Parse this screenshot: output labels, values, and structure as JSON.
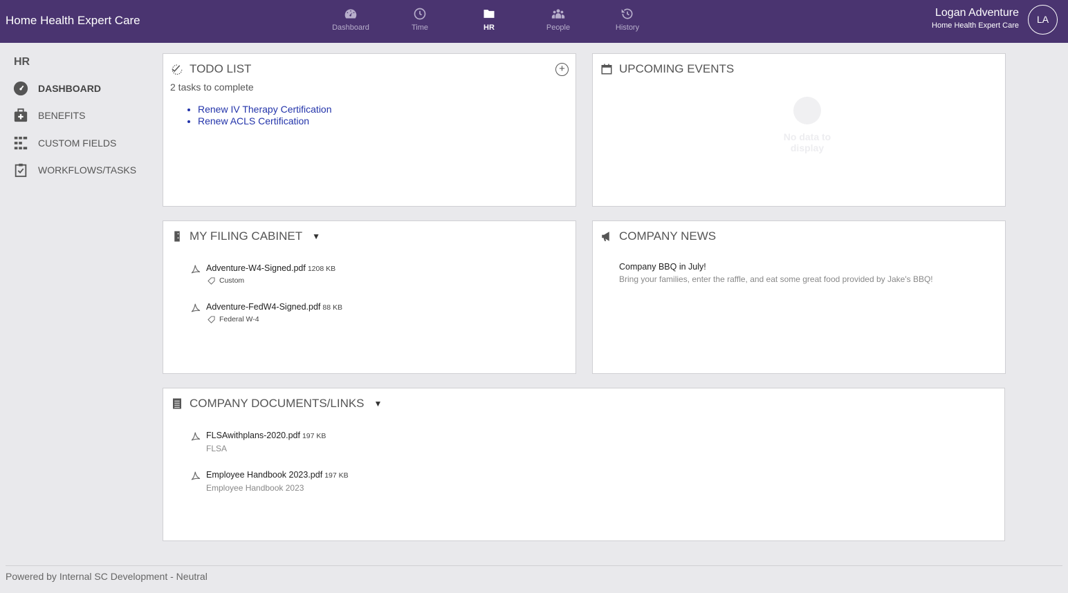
{
  "app": {
    "brand": "Home Health Expert Care"
  },
  "nav": [
    {
      "label": "Dashboard",
      "icon": "speedometer-icon",
      "active": false
    },
    {
      "label": "Time",
      "icon": "clock-icon",
      "active": false
    },
    {
      "label": "HR",
      "icon": "folder-icon",
      "active": true
    },
    {
      "label": "People",
      "icon": "people-icon",
      "active": false
    },
    {
      "label": "History",
      "icon": "history-icon",
      "active": false
    }
  ],
  "user": {
    "name": "Logan Adventure",
    "company": "Home Health Expert Care",
    "initials": "LA"
  },
  "sidebar": {
    "title": "HR",
    "items": [
      {
        "label": "DASHBOARD",
        "icon": "speedometer-icon",
        "active": true
      },
      {
        "label": "BENEFITS",
        "icon": "medical-bag-icon",
        "active": false
      },
      {
        "label": "CUSTOM FIELDS",
        "icon": "list-grid-icon",
        "active": false
      },
      {
        "label": "WORKFLOWS/TASKS",
        "icon": "clipboard-check-icon",
        "active": false
      }
    ]
  },
  "todo": {
    "title": "TODO LIST",
    "count_text": "2 tasks to complete",
    "add_symbol": "+",
    "items": [
      "Renew IV Therapy Certification",
      "Renew ACLS Certification"
    ]
  },
  "events": {
    "title": "UPCOMING EVENTS",
    "empty_text": "No data to display"
  },
  "filing": {
    "title": "MY FILING CABINET",
    "caret": "▼",
    "files": [
      {
        "name": "Adventure-W4-Signed.pdf",
        "size": "1208 KB",
        "tag": "Custom"
      },
      {
        "name": "Adventure-FedW4-Signed.pdf",
        "size": "88 KB",
        "tag": "Federal W-4"
      }
    ]
  },
  "news": {
    "title": "COMPANY NEWS",
    "items": [
      {
        "headline": "Company BBQ in July!",
        "body": "Bring your families, enter the raffle, and eat some great food provided by Jake's BBQ!"
      }
    ]
  },
  "docs": {
    "title": "COMPANY DOCUMENTS/LINKS",
    "caret": "▼",
    "files": [
      {
        "name": "FLSAwithplans-2020.pdf",
        "size": "197 KB",
        "sub": "FLSA"
      },
      {
        "name": "Employee Handbook 2023.pdf",
        "size": "197 KB",
        "sub": "Employee Handbook 2023"
      }
    ]
  },
  "footer": {
    "text": "Powered by Internal SC Development - Neutral"
  },
  "colors": {
    "topbar": "#4a3470",
    "link": "#2233aa"
  }
}
